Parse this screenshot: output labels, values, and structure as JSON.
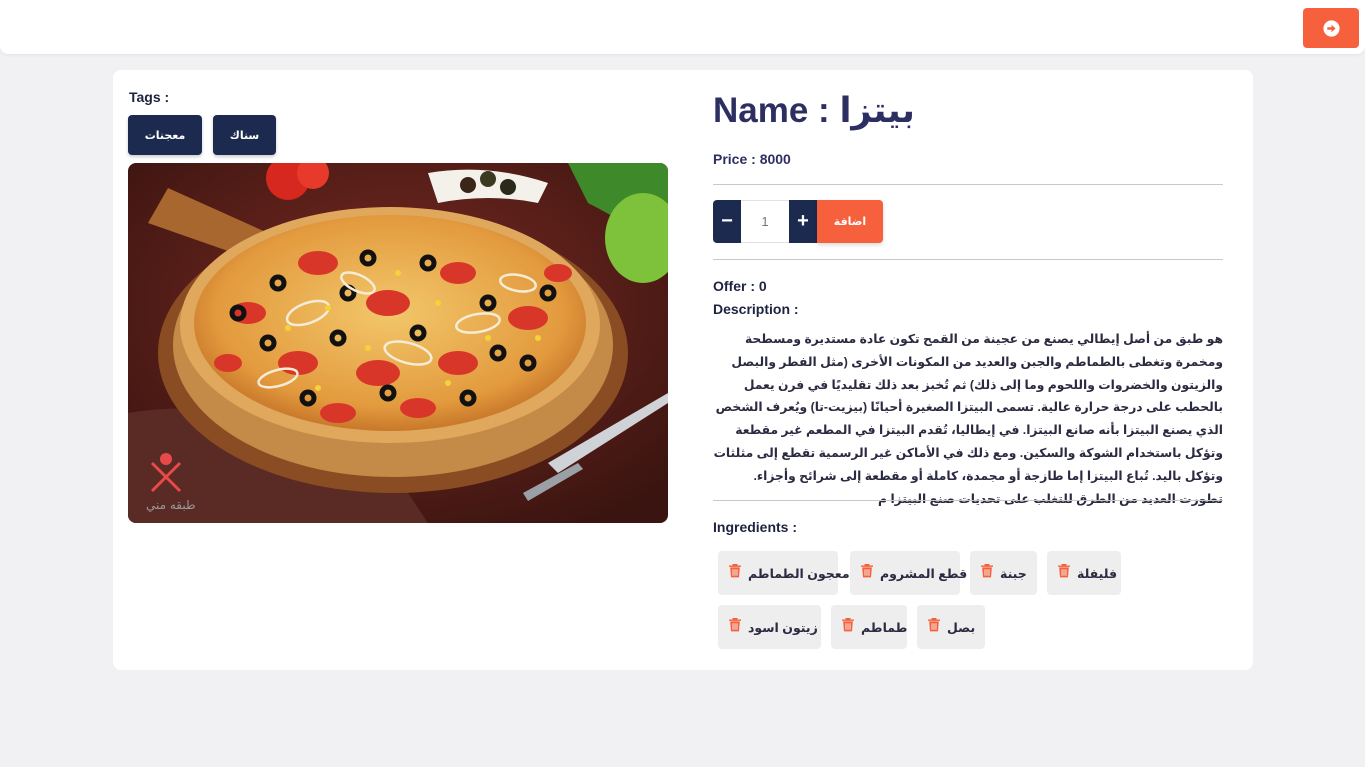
{
  "header": {
    "action_icon": "arrow-circle-right-icon",
    "accent_color": "#f7603c"
  },
  "product": {
    "tags_label": "Tags :",
    "tags": [
      "معجنات",
      "سناك"
    ],
    "image_alt": "pizza",
    "name_line": "Name : بيتزا",
    "price_line": "Price : 8000",
    "quantity_placeholder": "1",
    "minus_label": "−",
    "plus_label": "+",
    "add_label": "اضافة",
    "offer_line": "Offer : 0",
    "description_label": "Description :",
    "description": "هو طبق من أصل إيطالي يصنع من عجينة من القمح تكون عادة مستديرة ومسطحة ومخمرة وتغطى بالطماطم والجبن والعديد من المكونات الأخرى (مثل الفطر والبصل والزيتون والخضروات واللحوم وما إلى ذلك) ثم تُخبز بعد ذلك تقليديًا في فرن يعمل بالحطب على درجة حرارة عالية. تسمى البيتزا الصغيرة أحيانًا (بيزيت-تا) ويُعرف الشخص الذي يصنع البيتزا بأنه صانع البيتزا. في إيطاليا، تُقدم البيتزا في المطعم غير مقطعة وتؤكل باستخدام الشوكة والسكين. ومع ذلك في الأماكن غير الرسمية تقطع إلى مثلثات وتؤكل باليد. تُباع البيتزا إما طازجة أو مجمدة، كاملة أو مقطعة إلى شرائح وأجزاء. تطورت العديد من الطرق للتغلب على تحديات صنع البيتزا م",
    "ingredients_label": "Ingredients :",
    "ingredients": [
      "معجون الطماطم",
      "قطع المشروم",
      "جبنة",
      "فليفلة",
      "زيتون اسود",
      "طماطم",
      "بصل"
    ]
  },
  "colors": {
    "navy": "#1b2a4e",
    "orange": "#f7603c",
    "title": "#2d2f63"
  }
}
